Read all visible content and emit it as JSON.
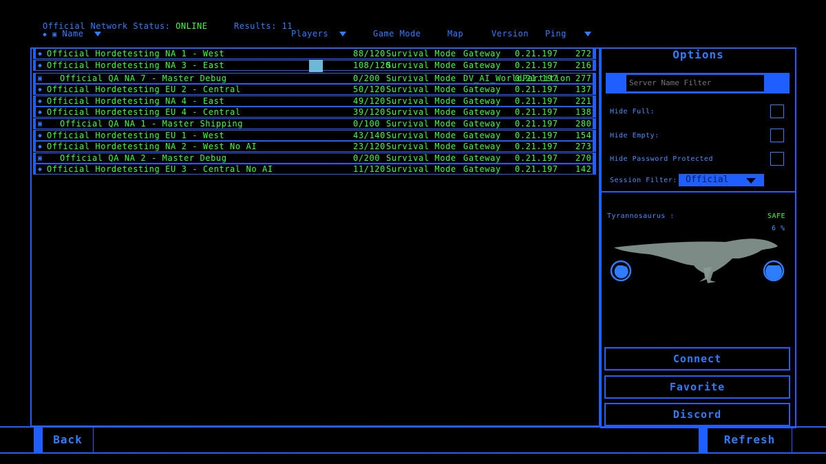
{
  "header": {
    "network_label": "Official Network Status:",
    "network_status": "ONLINE",
    "results_label": "Results:",
    "results_count": "11",
    "columns": {
      "name": "Name",
      "players": "Players",
      "game_mode": "Game Mode",
      "map": "Map",
      "version": "Version",
      "ping": "Ping"
    }
  },
  "servers": [
    {
      "icon": "shield-icon",
      "name": "Official Hordetesting NA 1 - West",
      "players": "88/120",
      "mode": "Survival Mode",
      "map": "Gateway",
      "version": "0.21.197",
      "ping": "272"
    },
    {
      "icon": "shield-icon",
      "name": "Official Hordetesting NA 3 - East",
      "players": "108/120",
      "mode": "Survival Mode",
      "map": "Gateway",
      "version": "0.21.197",
      "ping": "216"
    },
    {
      "icon": "lock-icon",
      "name": "Official QA NA 7 - Master Debug",
      "players": "0/200",
      "mode": "Survival Mode",
      "map": "DV_AI_WorldPartition",
      "version": "0.21.197",
      "ping": "277"
    },
    {
      "icon": "shield-icon",
      "name": "Official Hordetesting EU 2 - Central",
      "players": "50/120",
      "mode": "Survival Mode",
      "map": "Gateway",
      "version": "0.21.197",
      "ping": "137"
    },
    {
      "icon": "shield-icon",
      "name": "Official Hordetesting NA 4 - East",
      "players": "49/120",
      "mode": "Survival Mode",
      "map": "Gateway",
      "version": "0.21.197",
      "ping": "221"
    },
    {
      "icon": "shield-icon",
      "name": "Official Hordetesting EU 4 - Central",
      "players": "39/120",
      "mode": "Survival Mode",
      "map": "Gateway",
      "version": "0.21.197",
      "ping": "138"
    },
    {
      "icon": "lock-icon",
      "name": "Official QA NA 1 - Master Shipping",
      "players": "0/100",
      "mode": "Survival Mode",
      "map": "Gateway",
      "version": "0.21.197",
      "ping": "280"
    },
    {
      "icon": "shield-icon",
      "name": "Official Hordetesting EU 1 - West",
      "players": "43/140",
      "mode": "Survival Mode",
      "map": "Gateway",
      "version": "0.21.197",
      "ping": "154"
    },
    {
      "icon": "shield-icon",
      "name": "Official Hordetesting NA 2 - West No AI",
      "players": "23/120",
      "mode": "Survival Mode",
      "map": "Gateway",
      "version": "0.21.197",
      "ping": "273"
    },
    {
      "icon": "lock-icon",
      "name": "Official QA NA 2 - Master Debug",
      "players": "0/200",
      "mode": "Survival Mode",
      "map": "Gateway",
      "version": "0.21.197",
      "ping": "270"
    },
    {
      "icon": "shield-icon",
      "name": "Official Hordetesting EU 3 - Central No AI",
      "players": "11/120",
      "mode": "Survival Mode",
      "map": "Gateway",
      "version": "0.21.197",
      "ping": "142"
    }
  ],
  "options": {
    "title": "Options",
    "name_filter_placeholder": "Server Name Filter",
    "hide_full": "Hide Full:",
    "hide_empty": "Hide Empty:",
    "hide_password": "Hide Password Protected",
    "session_filter_label": "Session Filter:",
    "session_filter_value": "Official"
  },
  "dino": {
    "species": "Tyrannosaurus :",
    "status": "SAFE",
    "percent": "6 %"
  },
  "buttons": {
    "connect": "Connect",
    "favorite": "Favorite",
    "discord": "Discord",
    "back": "Back",
    "refresh": "Refresh"
  },
  "colors": {
    "accent": "#1f5fff",
    "text_blue": "#2f7dff",
    "online_green": "#39ff39",
    "background": "#000000"
  }
}
